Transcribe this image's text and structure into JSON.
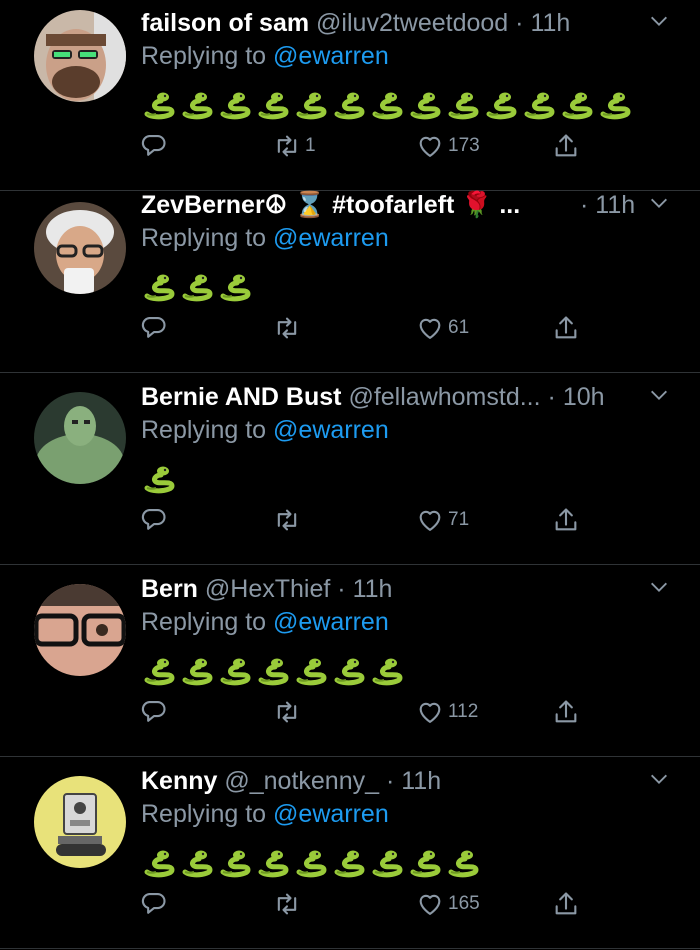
{
  "tweets": [
    {
      "name": "failson of sam",
      "handle": "@iluv2tweetdood",
      "time": "11h",
      "replying_label": "Replying to",
      "replying_to": "@ewarren",
      "emoji_count": 13,
      "emoji": "snake",
      "retweets": "1",
      "likes": "173"
    },
    {
      "name": "ZevBerner☮ ⌛ #toofarleft 🌹 ...",
      "handle": "",
      "time": "11h",
      "replying_label": "Replying to",
      "replying_to": "@ewarren",
      "emoji_count": 3,
      "emoji": "snake",
      "retweets": "",
      "likes": "61"
    },
    {
      "name": "Bernie AND Bust",
      "handle": "@fellawhomstd...",
      "time": "10h",
      "replying_label": "Replying to",
      "replying_to": "@ewarren",
      "emoji_count": 1,
      "emoji": "snake",
      "retweets": "",
      "likes": "71"
    },
    {
      "name": "Bern",
      "handle": "@HexThief",
      "time": "11h",
      "replying_label": "Replying to",
      "replying_to": "@ewarren",
      "emoji_count": 7,
      "emoji": "snake",
      "retweets": "",
      "likes": "112"
    },
    {
      "name": "Kenny",
      "handle": "@_notkenny_",
      "time": "11h",
      "replying_label": "Replying to",
      "replying_to": "@ewarren",
      "emoji_count": 9,
      "emoji": "snake",
      "retweets": "",
      "likes": "165"
    }
  ],
  "icons": {
    "reply": "reply-icon",
    "retweet": "retweet-icon",
    "like": "heart-icon",
    "share": "share-icon",
    "more": "chevron-down-icon"
  },
  "colors": {
    "background": "#000000",
    "secondary_text": "#8b98a5",
    "mention": "#1d9bf0",
    "snake": "#9acb3a"
  }
}
